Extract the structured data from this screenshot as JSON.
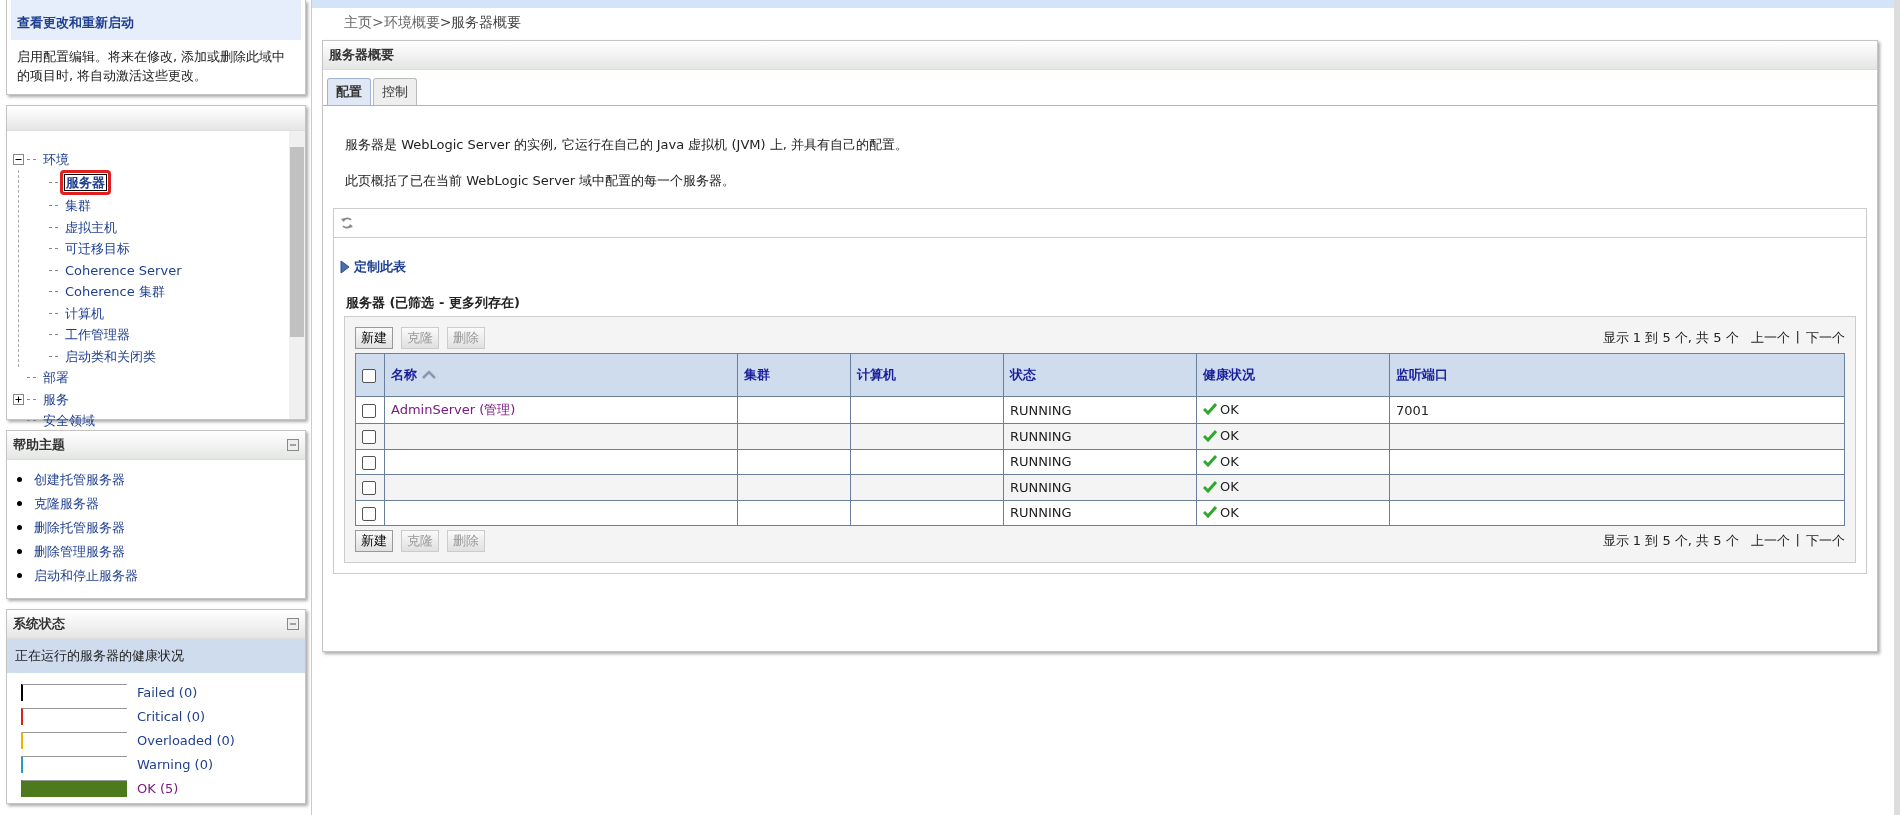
{
  "change_center": {
    "link": "查看更改和重新启动",
    "description": "启用配置编辑。将来在修改, 添加或删除此域中的项目时, 将自动激活这些更改。"
  },
  "domain_tree": {
    "items": [
      {
        "label": "环境",
        "expanded": true,
        "selected": false,
        "highlighted": false,
        "children": [
          {
            "label": "服务器",
            "selected": true,
            "highlighted": true
          },
          {
            "label": "集群",
            "selected": false,
            "highlighted": false
          },
          {
            "label": "虚拟主机",
            "selected": false,
            "highlighted": false
          },
          {
            "label": "可迁移目标",
            "selected": false,
            "highlighted": false
          },
          {
            "label": "Coherence Server",
            "selected": false,
            "highlighted": false
          },
          {
            "label": "Coherence 集群",
            "selected": false,
            "highlighted": false
          },
          {
            "label": "计算机",
            "selected": false,
            "highlighted": false
          },
          {
            "label": "工作管理器",
            "selected": false,
            "highlighted": false
          },
          {
            "label": "启动类和关闭类",
            "selected": false,
            "highlighted": false
          }
        ]
      },
      {
        "label": "部署",
        "selected": false,
        "highlighted": false
      },
      {
        "label": "服务",
        "expanded": false,
        "selected": false,
        "highlighted": false
      },
      {
        "label": "安全领域",
        "selected": false,
        "highlighted": false
      }
    ]
  },
  "help_topics": {
    "title": "帮助主题",
    "items": [
      "创建托管服务器",
      "克隆服务器",
      "删除托管服务器",
      "删除管理服务器",
      "启动和停止服务器"
    ]
  },
  "system_status": {
    "title": "系统状态",
    "subtitle": "正在运行的服务器的健康状况",
    "items": [
      {
        "label": "Failed (0)",
        "color": "#000000",
        "level": 0
      },
      {
        "label": "Critical (0)",
        "color": "#e02020",
        "level": 0
      },
      {
        "label": "Overloaded (0)",
        "color": "#f0b400",
        "level": 0
      },
      {
        "label": "Warning (0)",
        "color": "#2a9db0",
        "level": 0
      },
      {
        "label": "OK (5)",
        "color": "#4e7a1e",
        "level": 1
      }
    ]
  },
  "breadcrumb": [
    {
      "label": "主页",
      "kind": "link"
    },
    {
      "label": ">环境概要",
      "kind": "link"
    },
    {
      "label": ">服务器概要",
      "kind": "current"
    }
  ],
  "panel": {
    "title": "服务器概要",
    "tabs": [
      {
        "label": "配置",
        "selected": true
      },
      {
        "label": "控制",
        "selected": false
      }
    ],
    "intro": [
      "服务器是 WebLogic Server 的实例, 它运行在自己的 Java 虚拟机 (JVM) 上, 并具有自己的配置。",
      "此页概括了已在当前 WebLogic Server 域中配置的每一个服务器。"
    ],
    "customize_link": "定制此表",
    "table_title": "服务器 (已筛选 - 更多列存在)",
    "toolbars": [
      {
        "buttons": [
          {
            "label": "新建",
            "disabled": false
          },
          {
            "label": "克隆",
            "disabled": true
          },
          {
            "label": "删除",
            "disabled": true
          }
        ],
        "paging": {
          "summary": "显示 1 到 5 个, 共 5 个",
          "prev": "上一个",
          "separator": "|",
          "next": "下一个"
        }
      },
      {
        "buttons": [
          {
            "label": "新建",
            "disabled": false
          },
          {
            "label": "克隆",
            "disabled": true
          },
          {
            "label": "删除",
            "disabled": true
          }
        ],
        "paging": {
          "summary": "显示 1 到 5 个, 共 5 个",
          "prev": "上一个",
          "separator": "|",
          "next": "下一个"
        }
      }
    ],
    "select_all_checked": false,
    "columns": [
      "名称",
      "集群",
      "计算机",
      "状态",
      "健康状况",
      "监听端口"
    ],
    "rows": [
      {
        "checked": false,
        "name": "AdminServer (管理)",
        "cluster": "",
        "machine": "",
        "state": "RUNNING",
        "health": "OK",
        "port": "7001"
      },
      {
        "checked": false,
        "name": "",
        "cluster": "",
        "machine": "",
        "state": "RUNNING",
        "health": "OK",
        "port": ""
      },
      {
        "checked": false,
        "name": "",
        "cluster": "",
        "machine": "",
        "state": "RUNNING",
        "health": "OK",
        "port": ""
      },
      {
        "checked": false,
        "name": "",
        "cluster": "",
        "machine": "",
        "state": "RUNNING",
        "health": "OK",
        "port": ""
      },
      {
        "checked": false,
        "name": "",
        "cluster": "",
        "machine": "",
        "state": "RUNNING",
        "health": "OK",
        "port": ""
      }
    ]
  }
}
